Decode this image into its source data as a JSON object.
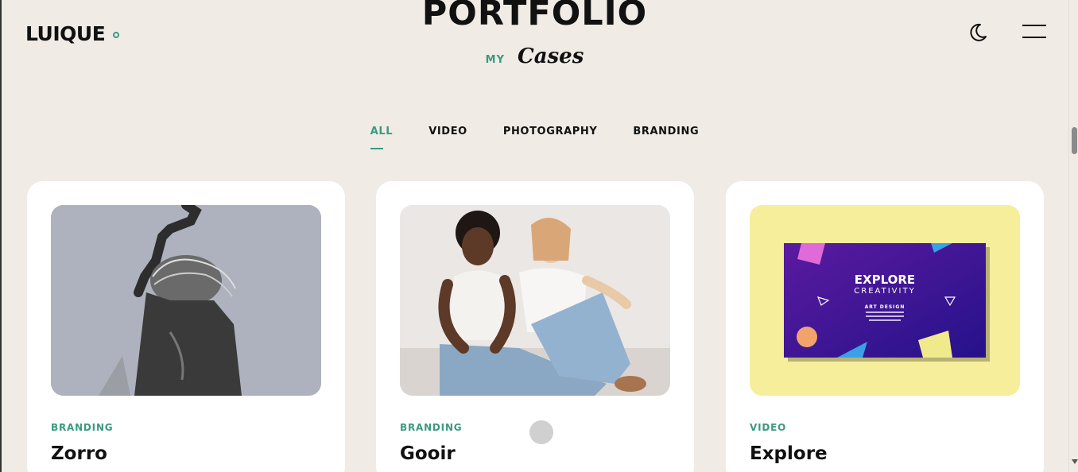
{
  "brand": {
    "name": "LUIQUE"
  },
  "header": {
    "title": "PORTFOLIO",
    "subtitle_small": "MY",
    "subtitle_script": "Cases"
  },
  "icons": {
    "theme_toggle": "moon-icon",
    "menu": "hamburger-menu-icon",
    "logo_dot": "circle-icon"
  },
  "filters": [
    {
      "label": "ALL",
      "active": true
    },
    {
      "label": "VIDEO",
      "active": false
    },
    {
      "label": "PHOTOGRAPHY",
      "active": false
    },
    {
      "label": "BRANDING",
      "active": false
    }
  ],
  "cards": [
    {
      "category": "BRANDING",
      "title": "Zorro"
    },
    {
      "category": "BRANDING",
      "title": "Gooir"
    },
    {
      "category": "VIDEO",
      "title": "Explore",
      "poster": {
        "headline": "EXPLORE",
        "subheadline": "CREATIVITY",
        "tag": "ART DESIGN"
      }
    }
  ],
  "colors": {
    "background": "#f0ebe5",
    "accent": "#3a9a80",
    "card": "#ffffff",
    "poster_bg": "#f7ee9c"
  }
}
